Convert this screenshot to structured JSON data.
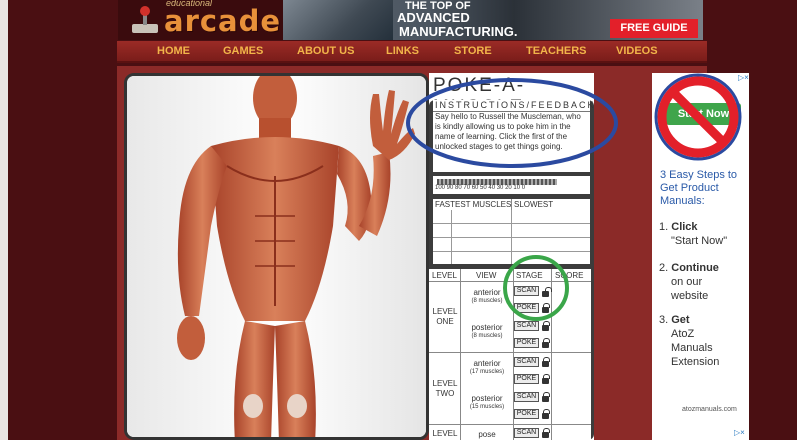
{
  "logo": {
    "small_text": "educational",
    "name": "arcade"
  },
  "ad_banner": {
    "line1": "THE TOP OF",
    "line2": "ADVANCED",
    "line3": "MANUFACTURING.",
    "cta": "FREE GUIDE"
  },
  "nav": {
    "items": [
      "HOME",
      "GAMES",
      "ABOUT US",
      "LINKS",
      "STORE",
      "TEACHERS",
      "VIDEOS"
    ]
  },
  "game": {
    "title": "POKE-A-MUSCLE",
    "instructions_title": "INSTRUCTIONS/FEEDBACK",
    "instructions_text": "Say hello to Russell the Muscleman, who is kindly allowing us to poke him in the name of learning. Click the first of the unlocked stages to get things going.",
    "speed_scale": "100 90 80 70 60 50 40 30 20 10 0",
    "fastest_header": "FASTEST MUSCLES",
    "slowest_header": "SLOWEST MUSCLES",
    "table_headers": {
      "level": "LEVEL",
      "view": "VIEW",
      "stage": "STAGE",
      "score": "SCORE"
    },
    "levels": [
      {
        "label": "LEVEL ONE",
        "views": [
          {
            "name": "anterior",
            "count": "(8 muscles)",
            "stages": [
              "SCAN",
              "POKE"
            ]
          },
          {
            "name": "posterior",
            "count": "(8 muscles)",
            "stages": [
              "SCAN",
              "POKE"
            ]
          }
        ]
      },
      {
        "label": "LEVEL TWO",
        "views": [
          {
            "name": "anterior",
            "count": "(17 muscles)",
            "stages": [
              "SCAN",
              "POKE"
            ]
          },
          {
            "name": "posterior",
            "count": "(15 muscles)",
            "stages": [
              "SCAN",
              "POKE"
            ]
          }
        ]
      },
      {
        "label": "LEVEL",
        "views": [
          {
            "name": "pose",
            "count": "",
            "stages": [
              "SCAN"
            ]
          }
        ]
      }
    ]
  },
  "right_ad": {
    "start_button": "Start Now",
    "headline": "3 Easy Steps to Get Product Manuals:",
    "steps": [
      {
        "num": "1.",
        "bold": "Click",
        "rest": "\"Start Now\""
      },
      {
        "num": "2.",
        "bold": "Continue",
        "rest": "on our website"
      },
      {
        "num": "3.",
        "bold": "Get",
        "rest": "AtoZ Manuals Extension"
      }
    ],
    "domain": "atozmanuals.com"
  },
  "colors": {
    "background": "#4a0f12",
    "nav": "#8b2a28",
    "nav_text": "#f2b54a",
    "logo": "#e8913a",
    "annotation_blue": "#2b4aa0",
    "annotation_green": "#3aa649",
    "annotation_red": "#e3202a"
  }
}
